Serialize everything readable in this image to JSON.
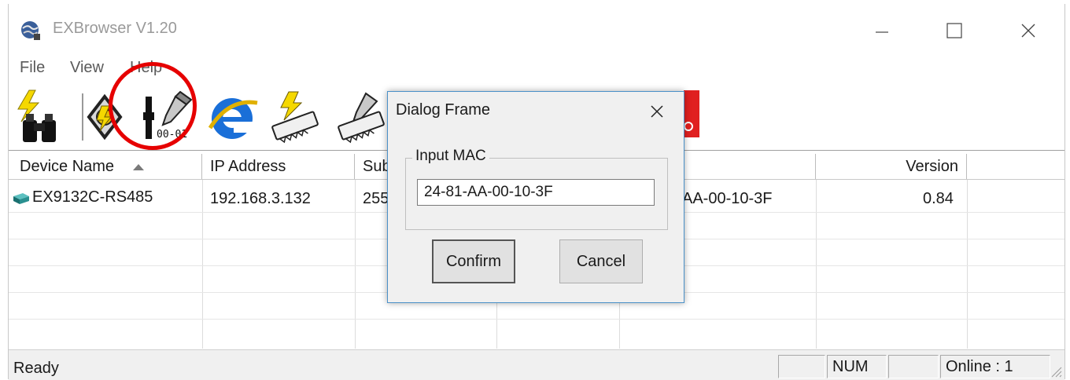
{
  "window": {
    "title": "EXBrowser V1.20",
    "controls": {
      "minimize": "minimize",
      "maximize": "maximize",
      "close": "close"
    }
  },
  "menu": {
    "items": [
      "File",
      "View",
      "Help"
    ]
  },
  "toolbar": {
    "buttons": [
      {
        "name": "search-devices",
        "icon": "binoculars-lightning-icon"
      },
      {
        "name": "change-ip",
        "icon": "ip-settings-icon"
      },
      {
        "name": "set-mac",
        "icon": "mac-edit-icon",
        "label": "00-01"
      },
      {
        "name": "web-browser",
        "icon": "internet-explorer-icon"
      },
      {
        "name": "firmware-update",
        "icon": "memory-chip-lightning-icon"
      },
      {
        "name": "edit-firmware",
        "icon": "memory-chip-edit-icon"
      },
      {
        "name": "extra-tool",
        "icon": "red-tool-icon"
      }
    ]
  },
  "device_list": {
    "columns": [
      {
        "label": "Device Name",
        "sort": "ascending"
      },
      {
        "label": "IP Address"
      },
      {
        "label": "Sub"
      },
      {
        "label": ""
      },
      {
        "label": ""
      },
      {
        "label": "Version"
      }
    ],
    "rows": [
      {
        "device_name": "EX9132C-RS485",
        "ip_address": "192.168.3.132",
        "subnet_partial": "255",
        "mac_partial": "AA-00-10-3F",
        "version": "0.84"
      }
    ]
  },
  "statusbar": {
    "ready": "Ready",
    "num": "NUM",
    "online": "Online : 1"
  },
  "dialog": {
    "title": "Dialog Frame",
    "group_label": "Input MAC",
    "mac_value": "24-81-AA-00-10-3F",
    "confirm": "Confirm",
    "cancel": "Cancel"
  },
  "colors": {
    "highlight_circle": "#e60000",
    "dialog_border": "#4a90c8",
    "device_icon": "#2a8c8c"
  }
}
